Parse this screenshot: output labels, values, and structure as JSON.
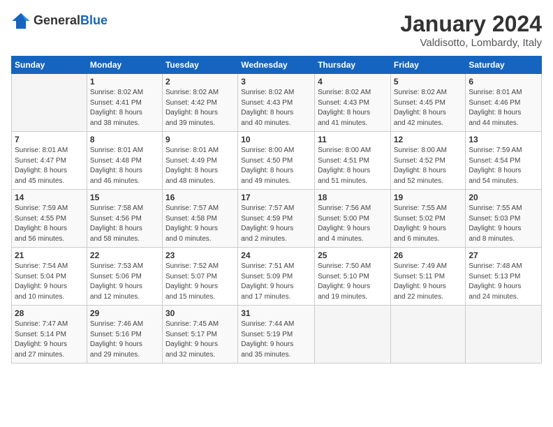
{
  "header": {
    "title": "January 2024",
    "subtitle": "Valdisotto, Lombardy, Italy"
  },
  "weekdays": [
    "Sunday",
    "Monday",
    "Tuesday",
    "Wednesday",
    "Thursday",
    "Friday",
    "Saturday"
  ],
  "weeks": [
    [
      {
        "day": "",
        "info": ""
      },
      {
        "day": "1",
        "info": "Sunrise: 8:02 AM\nSunset: 4:41 PM\nDaylight: 8 hours\nand 38 minutes."
      },
      {
        "day": "2",
        "info": "Sunrise: 8:02 AM\nSunset: 4:42 PM\nDaylight: 8 hours\nand 39 minutes."
      },
      {
        "day": "3",
        "info": "Sunrise: 8:02 AM\nSunset: 4:43 PM\nDaylight: 8 hours\nand 40 minutes."
      },
      {
        "day": "4",
        "info": "Sunrise: 8:02 AM\nSunset: 4:43 PM\nDaylight: 8 hours\nand 41 minutes."
      },
      {
        "day": "5",
        "info": "Sunrise: 8:02 AM\nSunset: 4:45 PM\nDaylight: 8 hours\nand 42 minutes."
      },
      {
        "day": "6",
        "info": "Sunrise: 8:01 AM\nSunset: 4:46 PM\nDaylight: 8 hours\nand 44 minutes."
      }
    ],
    [
      {
        "day": "7",
        "info": "Sunrise: 8:01 AM\nSunset: 4:47 PM\nDaylight: 8 hours\nand 45 minutes."
      },
      {
        "day": "8",
        "info": "Sunrise: 8:01 AM\nSunset: 4:48 PM\nDaylight: 8 hours\nand 46 minutes."
      },
      {
        "day": "9",
        "info": "Sunrise: 8:01 AM\nSunset: 4:49 PM\nDaylight: 8 hours\nand 48 minutes."
      },
      {
        "day": "10",
        "info": "Sunrise: 8:00 AM\nSunset: 4:50 PM\nDaylight: 8 hours\nand 49 minutes."
      },
      {
        "day": "11",
        "info": "Sunrise: 8:00 AM\nSunset: 4:51 PM\nDaylight: 8 hours\nand 51 minutes."
      },
      {
        "day": "12",
        "info": "Sunrise: 8:00 AM\nSunset: 4:52 PM\nDaylight: 8 hours\nand 52 minutes."
      },
      {
        "day": "13",
        "info": "Sunrise: 7:59 AM\nSunset: 4:54 PM\nDaylight: 8 hours\nand 54 minutes."
      }
    ],
    [
      {
        "day": "14",
        "info": "Sunrise: 7:59 AM\nSunset: 4:55 PM\nDaylight: 8 hours\nand 56 minutes."
      },
      {
        "day": "15",
        "info": "Sunrise: 7:58 AM\nSunset: 4:56 PM\nDaylight: 8 hours\nand 58 minutes."
      },
      {
        "day": "16",
        "info": "Sunrise: 7:57 AM\nSunset: 4:58 PM\nDaylight: 9 hours\nand 0 minutes."
      },
      {
        "day": "17",
        "info": "Sunrise: 7:57 AM\nSunset: 4:59 PM\nDaylight: 9 hours\nand 2 minutes."
      },
      {
        "day": "18",
        "info": "Sunrise: 7:56 AM\nSunset: 5:00 PM\nDaylight: 9 hours\nand 4 minutes."
      },
      {
        "day": "19",
        "info": "Sunrise: 7:55 AM\nSunset: 5:02 PM\nDaylight: 9 hours\nand 6 minutes."
      },
      {
        "day": "20",
        "info": "Sunrise: 7:55 AM\nSunset: 5:03 PM\nDaylight: 9 hours\nand 8 minutes."
      }
    ],
    [
      {
        "day": "21",
        "info": "Sunrise: 7:54 AM\nSunset: 5:04 PM\nDaylight: 9 hours\nand 10 minutes."
      },
      {
        "day": "22",
        "info": "Sunrise: 7:53 AM\nSunset: 5:06 PM\nDaylight: 9 hours\nand 12 minutes."
      },
      {
        "day": "23",
        "info": "Sunrise: 7:52 AM\nSunset: 5:07 PM\nDaylight: 9 hours\nand 15 minutes."
      },
      {
        "day": "24",
        "info": "Sunrise: 7:51 AM\nSunset: 5:09 PM\nDaylight: 9 hours\nand 17 minutes."
      },
      {
        "day": "25",
        "info": "Sunrise: 7:50 AM\nSunset: 5:10 PM\nDaylight: 9 hours\nand 19 minutes."
      },
      {
        "day": "26",
        "info": "Sunrise: 7:49 AM\nSunset: 5:11 PM\nDaylight: 9 hours\nand 22 minutes."
      },
      {
        "day": "27",
        "info": "Sunrise: 7:48 AM\nSunset: 5:13 PM\nDaylight: 9 hours\nand 24 minutes."
      }
    ],
    [
      {
        "day": "28",
        "info": "Sunrise: 7:47 AM\nSunset: 5:14 PM\nDaylight: 9 hours\nand 27 minutes."
      },
      {
        "day": "29",
        "info": "Sunrise: 7:46 AM\nSunset: 5:16 PM\nDaylight: 9 hours\nand 29 minutes."
      },
      {
        "day": "30",
        "info": "Sunrise: 7:45 AM\nSunset: 5:17 PM\nDaylight: 9 hours\nand 32 minutes."
      },
      {
        "day": "31",
        "info": "Sunrise: 7:44 AM\nSunset: 5:19 PM\nDaylight: 9 hours\nand 35 minutes."
      },
      {
        "day": "",
        "info": ""
      },
      {
        "day": "",
        "info": ""
      },
      {
        "day": "",
        "info": ""
      }
    ]
  ]
}
